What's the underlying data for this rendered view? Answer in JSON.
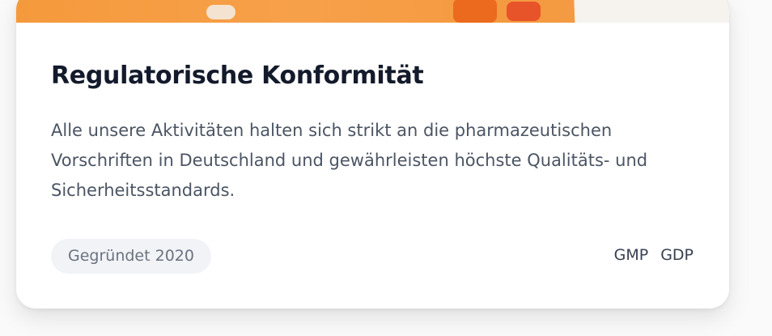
{
  "card": {
    "title": "Regulatorische Konformität",
    "description": "Alle unsere Aktivitäten halten sich strikt an die pharmazeutischen Vorschriften in Deutschland und gewährleisten höchste Qualitäts- und Sicherheitsstandards.",
    "badge": "Gegründet 2020",
    "certifications": [
      "GMP",
      "GDP"
    ]
  },
  "colors": {
    "title": "#131a2b",
    "text": "#4b5563",
    "badge_bg": "#f1f3f6",
    "badge_text": "#6b7280",
    "image_accent": "#f59a3c"
  }
}
